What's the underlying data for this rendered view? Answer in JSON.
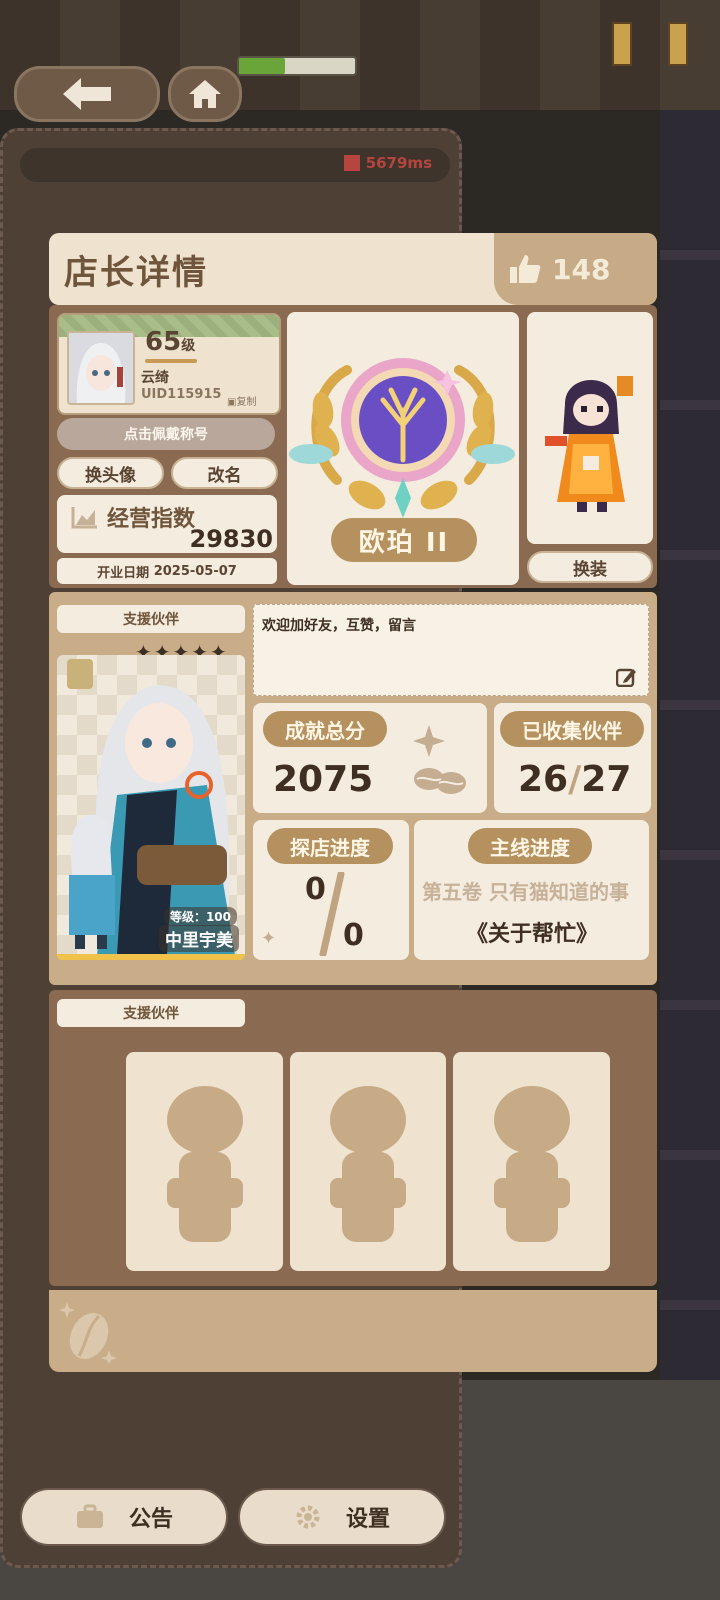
{
  "header": {
    "ping": "5679ms"
  },
  "card": {
    "title": "店长详情",
    "likes": "148"
  },
  "profile": {
    "level_number": "65",
    "level_suffix": "级",
    "name": "云绮",
    "uid": "UID115915",
    "copy_label": "复制",
    "wear_title_label": "点击佩戴称号",
    "change_avatar_label": "换头像",
    "rename_label": "改名",
    "score_label": "经营指数",
    "score_value": "29830",
    "open_date_label": "开业日期",
    "open_date": "2025-05-07"
  },
  "rank": {
    "name": "欧珀 II"
  },
  "outfit": {
    "button_label": "换装"
  },
  "partner": {
    "section_label": "支援伙伴",
    "level_label": "等级：100",
    "name": "中里宇美"
  },
  "message": {
    "text": "欢迎加好友，互赞，留言"
  },
  "stats": {
    "achievement_label": "成就总分",
    "achievement_value": "2075",
    "collected_label": "已收集伙伴",
    "collected_current": "26",
    "collected_total": "27",
    "explore_label": "探店进度",
    "explore_current": "0",
    "explore_total": "0",
    "main_label": "主线进度",
    "main_chapter": "第五卷 只有猫知道的事",
    "main_story": "《关于帮忙》"
  },
  "support": {
    "section_label": "支援伙伴",
    "slots": 3
  },
  "bottom_bar": {
    "notice_label": "公告",
    "settings_label": "设置"
  },
  "colors": {
    "panel_brown": "#8a6b52",
    "cream": "#efe3cf",
    "accent_gold": "#b4915f",
    "ping_red": "#b4453f"
  }
}
